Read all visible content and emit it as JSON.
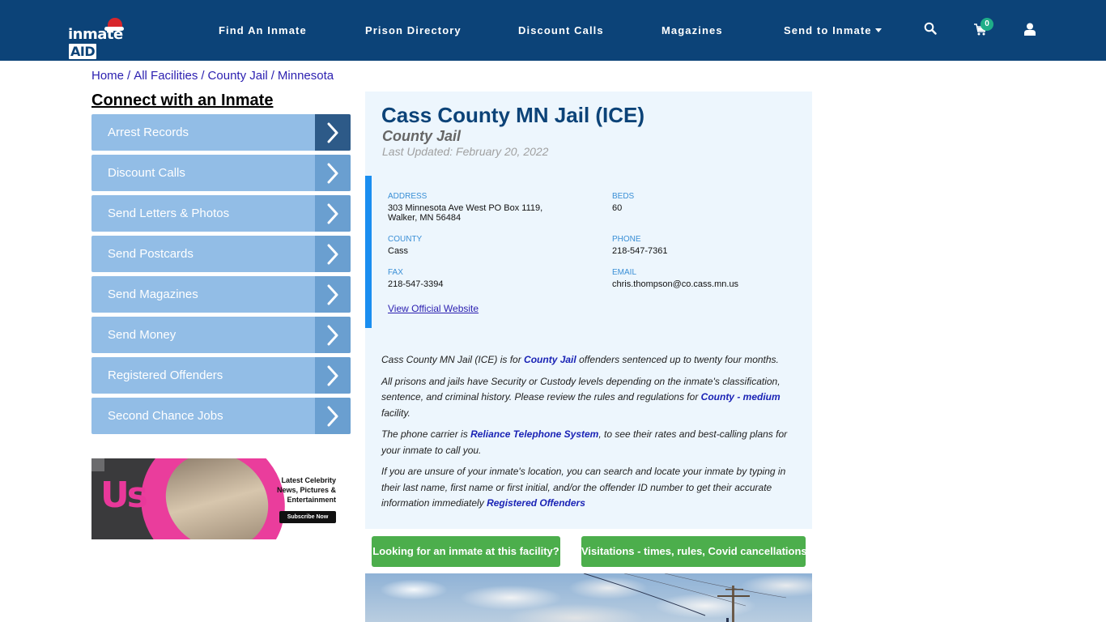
{
  "header": {
    "logo_text": "inmate",
    "logo_aid": "AID",
    "nav": [
      {
        "label": "Find An Inmate"
      },
      {
        "label": "Prison Directory"
      },
      {
        "label": "Discount Calls"
      },
      {
        "label": "Magazines"
      },
      {
        "label": "Send to Inmate",
        "has_dropdown": true
      }
    ],
    "icons": [
      "search-icon",
      "cart-icon",
      "user-icon"
    ],
    "cart_count": "0"
  },
  "breadcrumb": [
    {
      "label": "Home"
    },
    {
      "label": "All Facilities"
    },
    {
      "label": "County Jail"
    },
    {
      "label": "Minnesota"
    }
  ],
  "breadcrumb_separator": "/",
  "sidebar": {
    "title": "Connect with an Inmate",
    "items": [
      {
        "label": "Arrest Records",
        "active": true
      },
      {
        "label": "Discount Calls"
      },
      {
        "label": "Send Letters & Photos"
      },
      {
        "label": "Send Postcards"
      },
      {
        "label": "Send Magazines"
      },
      {
        "label": "Send Money"
      },
      {
        "label": "Registered Offenders"
      },
      {
        "label": "Second Chance Jobs"
      }
    ],
    "ad": {
      "brand": "Us",
      "line1": "Latest Celebrity",
      "line2": "News, Pictures &",
      "line3": "Entertainment",
      "button": "Subscribe Now"
    }
  },
  "facility": {
    "name": "Cass County MN Jail (ICE)",
    "type": "County Jail",
    "last_updated": "Last Updated: February 20, 2022",
    "info": {
      "address_label": "ADDRESS",
      "address_line1": "303 Minnesota Ave West PO Box 1119,",
      "address_line2": "Walker, MN 56484",
      "beds_label": "BEDS",
      "beds": "60",
      "county_label": "COUNTY",
      "county": "Cass",
      "phone_label": "PHONE",
      "phone": "218-547-7361",
      "fax_label": "FAX",
      "fax": "218-547-3394",
      "email_label": "EMAIL",
      "email": "chris.thompson@co.cass.mn.us",
      "website_link": "View Official Website"
    },
    "description": {
      "p1_a": "Cass County MN Jail (ICE) is for ",
      "p1_link": "County Jail",
      "p1_b": " offenders sentenced up to twenty four months.",
      "p2_a": "All prisons and jails have Security or Custody levels depending on the inmate's classification, sentence, and criminal history. Please review the rules and regulations for ",
      "p2_link": "County - medium",
      "p2_b": " facility.",
      "p3_a": "The phone carrier is ",
      "p3_link": "Reliance Telephone System",
      "p3_b": ", to see their rates and best-calling plans for your inmate to call you.",
      "p4_a": "If you are unsure of your inmate's location, you can search and locate your inmate by typing in their last name, first name or first initial, and/or the offender ID number to get their accurate information immediately ",
      "p4_link": "Registered Offenders"
    }
  },
  "buttons": {
    "find_inmate": "Looking for an inmate at this facility?",
    "visitations": "Visitations - times, rules, Covid cancellations"
  },
  "colors": {
    "header_bg": "#0c4378",
    "sidebar_item": "#92bde6",
    "sidebar_chevron": "#6a9fd0",
    "sidebar_chevron_active": "#2d5a88",
    "panel_bg": "#edf6fd",
    "accent_bar": "#1a8ef0",
    "green_button": "#4cae4c",
    "link": "#1a23b5"
  }
}
